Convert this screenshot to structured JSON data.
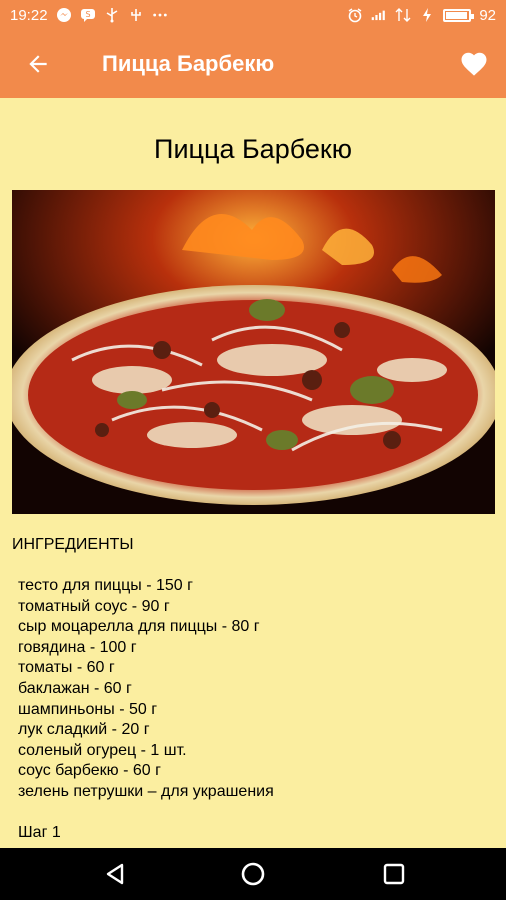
{
  "status_bar": {
    "time": "19:22",
    "battery_level": "92",
    "battery_fill": 0.92,
    "icons": [
      "messenger-icon",
      "chat-icon",
      "usb-icon",
      "usb-debug-icon",
      "more-dots-icon",
      "alarm-icon",
      "signal-icon",
      "data-icon",
      "charging-icon",
      "battery-icon"
    ]
  },
  "app_bar": {
    "title": "Пицца Барбекю",
    "back_icon": "arrow-back-icon",
    "favorite_icon": "heart-icon"
  },
  "recipe": {
    "title": "Пицца Барбекю",
    "photo": "pizza-photo",
    "ingredients_heading": "ИНГРЕДИЕНТЫ",
    "ingredients": [
      "тесто для пиццы - 150 г",
      "томатный соус - 90 г",
      "сыр моцарелла для пиццы - 80 г",
      "говядина - 100 г",
      "томаты - 60 г",
      "баклажан - 60 г",
      "шампиньоны - 50 г",
      "лук сладкий - 20 г",
      "соленый огурец - 1 шт.",
      "соус барбекю - 60 г",
      "зелень петрушки – для украшения"
    ],
    "step_label": "Шаг 1"
  },
  "colors": {
    "accent": "#f28a4b",
    "background": "#fbeea0",
    "nav_bar": "#000000"
  },
  "nav_bar": {
    "buttons": [
      "back-triangle-icon",
      "home-circle-icon",
      "recents-square-icon"
    ]
  }
}
